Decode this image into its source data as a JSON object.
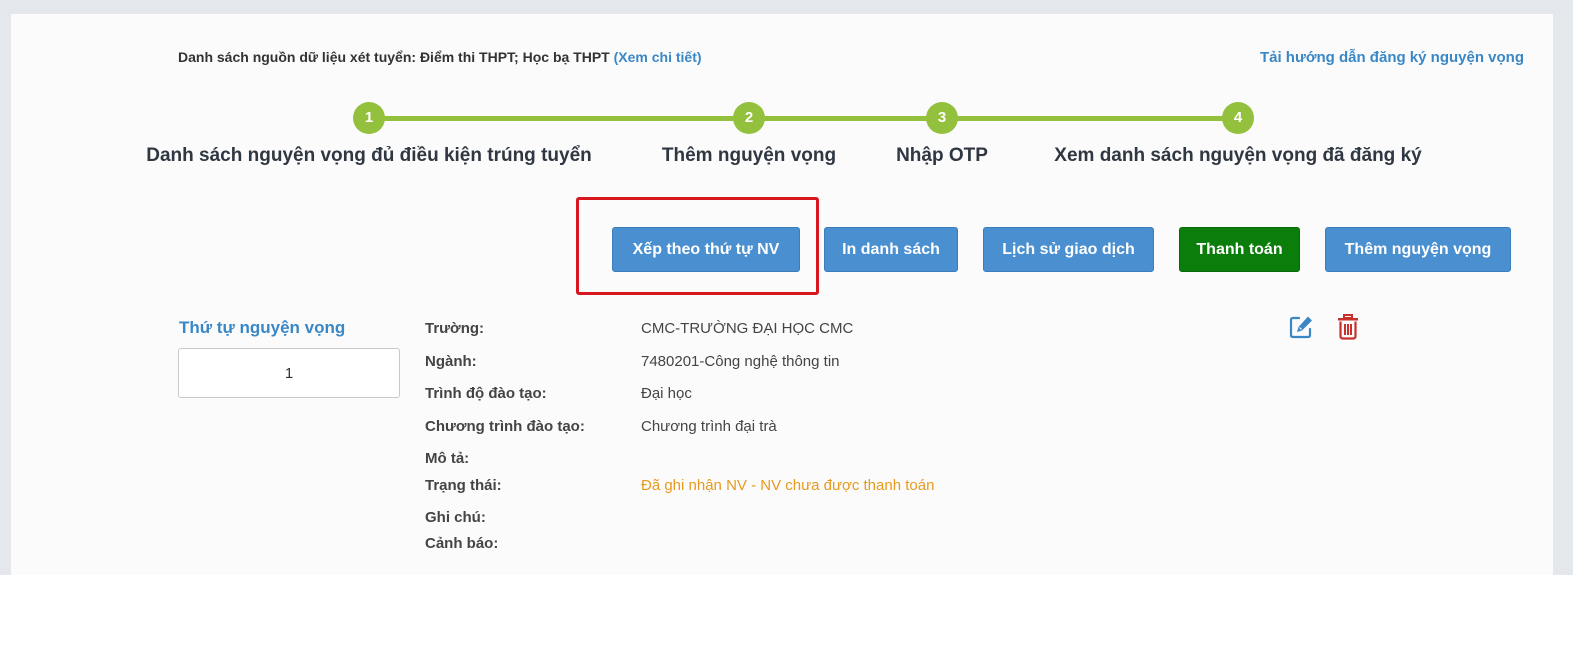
{
  "header": {
    "source_label": "Danh sách nguồn dữ liệu xét tuyển: Điểm thi THPT; Học bạ THPT",
    "source_link": "(Xem chi tiết)",
    "guide_link": "Tải hướng dẫn đăng ký nguyện vọng"
  },
  "steps": [
    {
      "number": "1",
      "label": "Danh sách nguyện vọng đủ điều kiện trúng tuyển"
    },
    {
      "number": "2",
      "label": "Thêm nguyện vọng"
    },
    {
      "number": "3",
      "label": "Nhập OTP"
    },
    {
      "number": "4",
      "label": "Xem danh sách nguyện vọng đã đăng ký"
    }
  ],
  "toolbar": {
    "sort_label": "Xếp theo thứ tự NV",
    "print_label": "In danh sách",
    "history_label": "Lịch sử giao dịch",
    "pay_label": "Thanh toán",
    "add_label": "Thêm nguyện vọng"
  },
  "wish": {
    "order_title": "Thứ tự nguyện vọng",
    "order_value": "1",
    "fields": [
      {
        "label": "Trường:",
        "value": "CMC-TRƯỜNG ĐẠI HỌC CMC"
      },
      {
        "label": "Ngành:",
        "value": "7480201-Công nghệ thông tin"
      },
      {
        "label": "Trình độ đào tạo:",
        "value": "Đại học"
      },
      {
        "label": "Chương trình đào tạo:",
        "value": "Chương trình đại trà"
      },
      {
        "label": "Mô tả:",
        "value": ""
      },
      {
        "label": "Trạng thái:",
        "value": "Đã ghi nhận NV - NV chưa được thanh toán"
      },
      {
        "label": "Ghi chú:",
        "value": ""
      },
      {
        "label": "Cảnh báo:",
        "value": ""
      }
    ]
  },
  "icons": {
    "edit": "edit-icon",
    "delete": "trash-icon"
  },
  "colors": {
    "step_green": "#94c13d",
    "button_blue": "#4a8fd0",
    "button_green": "#0a7d0a",
    "link_blue": "#3a87c6",
    "status_orange": "#e69a1f",
    "highlight_red": "#d8161d",
    "delete_red": "#c9302c"
  }
}
